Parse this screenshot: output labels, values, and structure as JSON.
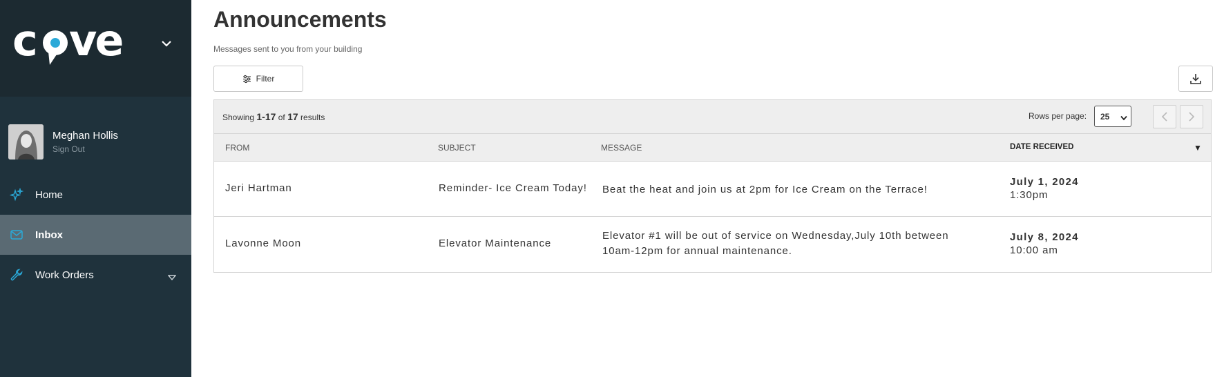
{
  "brand": {
    "logo_text": "cove",
    "accent_color": "#2aa9d8"
  },
  "sidebar": {
    "user": {
      "name": "Meghan Hollis",
      "signout": "Sign Out"
    },
    "items": [
      {
        "label": "Home",
        "icon": "sparkle-icon"
      },
      {
        "label": "Inbox",
        "icon": "envelope-icon",
        "active": true
      },
      {
        "label": "Work Orders",
        "icon": "wrench-icon",
        "expandable": true
      }
    ]
  },
  "page": {
    "title": "Announcements",
    "subtitle": "Messages sent to you from your building",
    "filter_label": "Filter"
  },
  "table": {
    "showing_prefix": "Showing",
    "showing_range": "1-17",
    "showing_of": "of",
    "showing_total": "17",
    "showing_suffix": "results",
    "rows_per_page_label": "Rows per page:",
    "rows_per_page_value": "25",
    "columns": [
      "FROM",
      "SUBJECT",
      "MESSAGE",
      "DATE RECEIVED"
    ],
    "sort_indicator": "▼",
    "rows": [
      {
        "from": "Jeri Hartman",
        "subject": "Reminder- Ice Cream Today!",
        "message": "Beat the heat and join us at 2pm for Ice Cream on the Terrace!",
        "date": "July 1, 2024",
        "time": "1:30pm"
      },
      {
        "from": "Lavonne Moon",
        "subject": "Elevator Maintenance",
        "message": "Elevator #1 will be out of service on Wednesday,July 10th between 10am-12pm for annual maintenance.",
        "date": "July 8, 2024",
        "time": "10:00 am"
      }
    ]
  }
}
